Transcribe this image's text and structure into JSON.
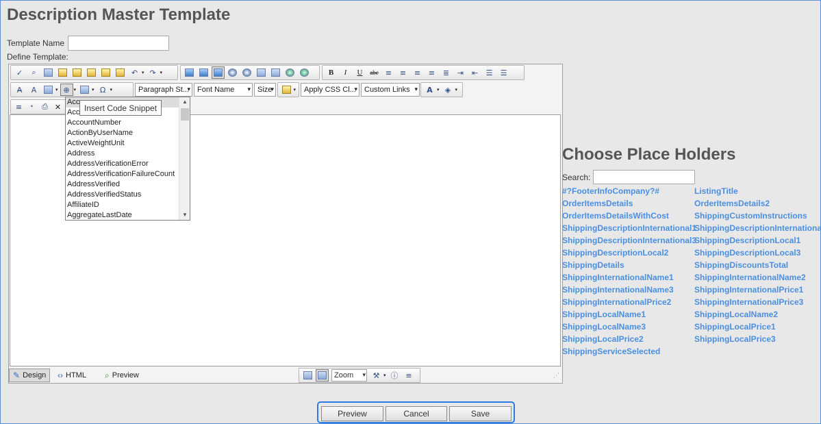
{
  "page": {
    "title": "Description Master Template"
  },
  "form": {
    "template_name_label": "Template Name",
    "template_name_value": "",
    "define_label": "Define Template:"
  },
  "toolbar": {
    "paragraph_style": "Paragraph St...",
    "font_name": "Font Name",
    "size": "Size",
    "apply_css": "Apply CSS Cl...",
    "custom_links": "Custom Links",
    "bold": "B",
    "italic": "I",
    "underline": "U",
    "strike": "abc",
    "omega": "Ω"
  },
  "tooltip": "Insert Code Snippet",
  "snippets": [
    "Acc",
    "Acc",
    "AccountNumber",
    "ActionByUserName",
    "ActiveWeightUnit",
    "Address",
    "AddressVerificationError",
    "AddressVerificationFailureCount",
    "AddressVerified",
    "AddressVerifiedStatus",
    "AffiliateID",
    "AggregateLastDate"
  ],
  "editor_modes": {
    "design": "Design",
    "html": "HTML",
    "preview": "Preview"
  },
  "zoom_label": "Zoom",
  "placeholders": {
    "title": "Choose Place Holders",
    "search_label": "Search:",
    "search_value": "",
    "left": [
      "#?FooterInfoCompany?#",
      "OrderItemsDetails",
      "OrderItemsDetailsWithCost",
      "ShippingDescriptionInternational1",
      "ShippingDescriptionInternational3",
      "ShippingDescriptionLocal2",
      "ShippingDetails",
      "ShippingInternationalName1",
      "ShippingInternationalName3",
      "ShippingInternationalPrice2",
      "ShippingLocalName1",
      "ShippingLocalName3",
      "ShippingLocalPrice2",
      "ShippingServiceSelected"
    ],
    "right": [
      "ListingTitle",
      "OrderItemsDetails2",
      "ShippingCustomInstructions",
      "ShippingDescriptionInternational",
      "ShippingDescriptionLocal1",
      "ShippingDescriptionLocal3",
      "ShippingDiscountsTotal",
      "ShippingInternationalName2",
      "ShippingInternationalPrice1",
      "ShippingInternationalPrice3",
      "ShippingLocalName2",
      "ShippingLocalPrice1",
      "ShippingLocalPrice3"
    ]
  },
  "actions": {
    "preview": "Preview",
    "cancel": "Cancel",
    "save": "Save"
  },
  "colors": {
    "link": "#4a8fe0",
    "focus_border": "#2b7be3"
  }
}
